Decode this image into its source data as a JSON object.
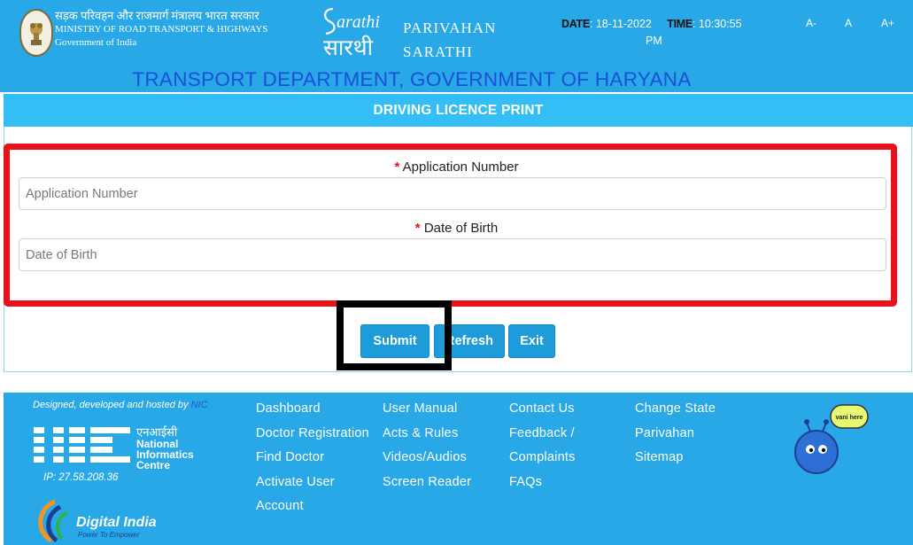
{
  "header": {
    "ministry_hindi": "सड़क परिवहन और राजमार्ग मंत्रालय भारत सरकार",
    "ministry_english": "MINISTRY OF ROAD TRANSPORT & HIGHWAYS",
    "government": "Government of India",
    "brand_line1": "PARIVAHAN",
    "brand_line2": "SARATHI",
    "date_label": "DATE",
    "date_value": ": 18-11-2022",
    "time_label": "TIME",
    "time_value": ": 10:30:55",
    "ampm": "PM",
    "font_small": "A-",
    "font_normal": "A",
    "font_large": "A+",
    "department": "TRANSPORT DEPARTMENT, GOVERNMENT OF HARYANA"
  },
  "page": {
    "title": "DRIVING LICENCE PRINT"
  },
  "form": {
    "required_mark": "*",
    "application_label": "Application Number",
    "application_placeholder": "Application Number",
    "dob_label": "Date of Birth",
    "dob_placeholder": "Date of Birth"
  },
  "buttons": {
    "submit": "Submit",
    "refresh": "Refresh",
    "exit": "Exit"
  },
  "footer": {
    "designed_by": "Designed, developed and hosted by",
    "designed_by_link": "NIC",
    "ip": "IP: 27.58.208.36",
    "links": {
      "dashboard": "Dashboard",
      "doctor_registration": "Doctor Registration",
      "find_doctor": "Find Doctor",
      "activate_user": "Activate User",
      "account": "Account",
      "user_manual": "User Manual",
      "acts_rules": "Acts & Rules",
      "videos_audios": "Videos/Audios",
      "screen_reader": "Screen Reader",
      "contact_us": "Contact Us",
      "feedback": "Feedback /",
      "complaints": "Complaints",
      "faqs": "FAQs",
      "change_state": "Change State",
      "parivahan": "Parivahan",
      "sitemap": "Sitemap"
    },
    "mascot_bubble": "vani here"
  },
  "logos": {
    "sarathi_latin": "arathi",
    "sarathi_hindi": "सारथी",
    "nic_hindi": "एनआईसी",
    "nic_line1": "National",
    "nic_line2": "Informatics",
    "nic_line3": "Centre",
    "digital_india": "Digital India",
    "digital_tagline": "Power To Empower"
  },
  "colors": {
    "header_blue": "#29a8e8",
    "title_bar": "#33bff5",
    "department_text": "#1a4fd6",
    "button_blue": "#1e9bd9",
    "red_highlight": "#e8121d",
    "black_highlight": "#000000"
  }
}
